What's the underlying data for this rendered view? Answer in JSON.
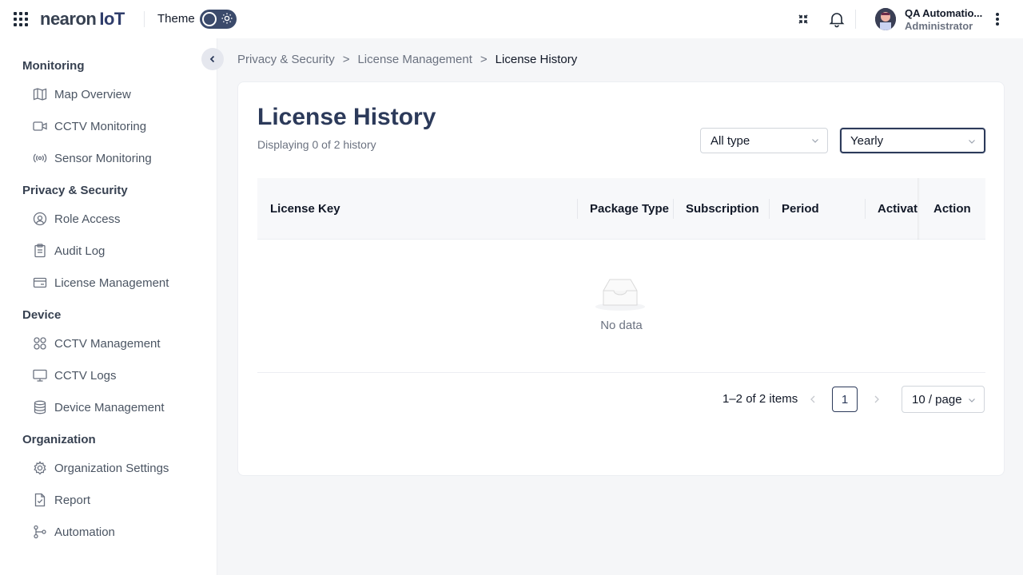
{
  "header": {
    "logo_main": "nearon",
    "logo_suffix": "IoT",
    "theme_label": "Theme",
    "user_name": "QA Automatio...",
    "user_role": "Administrator"
  },
  "sidebar": {
    "sections": [
      {
        "title": "Monitoring",
        "items": [
          {
            "label": "Map Overview",
            "icon": "map-icon"
          },
          {
            "label": "CCTV Monitoring",
            "icon": "video-icon"
          },
          {
            "label": "Sensor Monitoring",
            "icon": "broadcast-icon"
          }
        ]
      },
      {
        "title": "Privacy & Security",
        "items": [
          {
            "label": "Role Access",
            "icon": "role-icon"
          },
          {
            "label": "Audit Log",
            "icon": "clipboard-icon"
          },
          {
            "label": "License Management",
            "icon": "card-icon"
          }
        ]
      },
      {
        "title": "Device",
        "items": [
          {
            "label": "CCTV Management",
            "icon": "grid-icon"
          },
          {
            "label": "CCTV Logs",
            "icon": "monitor-icon"
          },
          {
            "label": "Device Management",
            "icon": "database-icon"
          }
        ]
      },
      {
        "title": "Organization",
        "items": [
          {
            "label": "Organization Settings",
            "icon": "gear-icon"
          },
          {
            "label": "Report",
            "icon": "file-check-icon"
          },
          {
            "label": "Automation",
            "icon": "flow-icon"
          }
        ]
      }
    ]
  },
  "breadcrumb": {
    "items": [
      "Privacy & Security",
      "License Management",
      "License History"
    ],
    "separator": ">"
  },
  "page": {
    "title": "License History",
    "subtitle": "Displaying 0 of 2 history"
  },
  "filters": {
    "type_value": "All type",
    "period_value": "Yearly"
  },
  "table": {
    "columns": [
      "License Key",
      "Package Type",
      "Subscription",
      "Period",
      "Activati",
      "Action"
    ],
    "empty_text": "No data"
  },
  "pagination": {
    "total_text": "1–2 of 2 items",
    "prev": "<",
    "next": ">",
    "current_page": "1",
    "page_size": "10 / page"
  },
  "colors": {
    "primary": "#2c3a5a",
    "toggle": "#3b4a6b"
  }
}
